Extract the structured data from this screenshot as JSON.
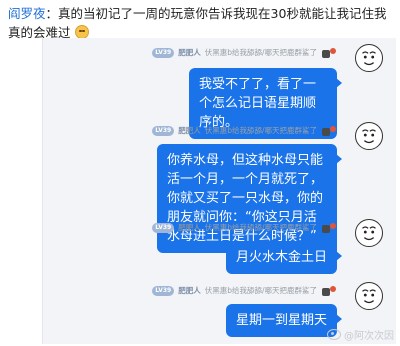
{
  "post": {
    "author": "阎罗夜",
    "separator": "：",
    "text": "真的当初记了一周的玩意你告诉我现在30秒就能让我记住我真的会难过",
    "emoji": "smiling-face-icon"
  },
  "chat": {
    "sender": {
      "level": "LV39",
      "nickname": "肥肥人",
      "signature": "伏黑惠b给我舔舔/哪天把鹿群鲨了",
      "badge_icon": "dual-badge-icon",
      "avatar_icon": "doodle-face-avatar-icon"
    },
    "messages": [
      {
        "text": "我受不了了，看了一个怎么记日语星期顺序的。"
      },
      {
        "text": "你养水母，但这种水母只能活一个月，一个月就死了，你就又买了一只水母，你的朋友就问你：“你这只月活水母进土日是什么时候？”"
      },
      {
        "text": "月火水木金土日"
      },
      {
        "text": "星期一到星期天"
      }
    ]
  },
  "watermark": {
    "text": "@阿次次因",
    "icon": "weibo-logo-icon"
  },
  "colors": {
    "bubble": "#1a73e8",
    "chat_bg": "#f2f4f7",
    "author_link": "#1d6ed8"
  }
}
